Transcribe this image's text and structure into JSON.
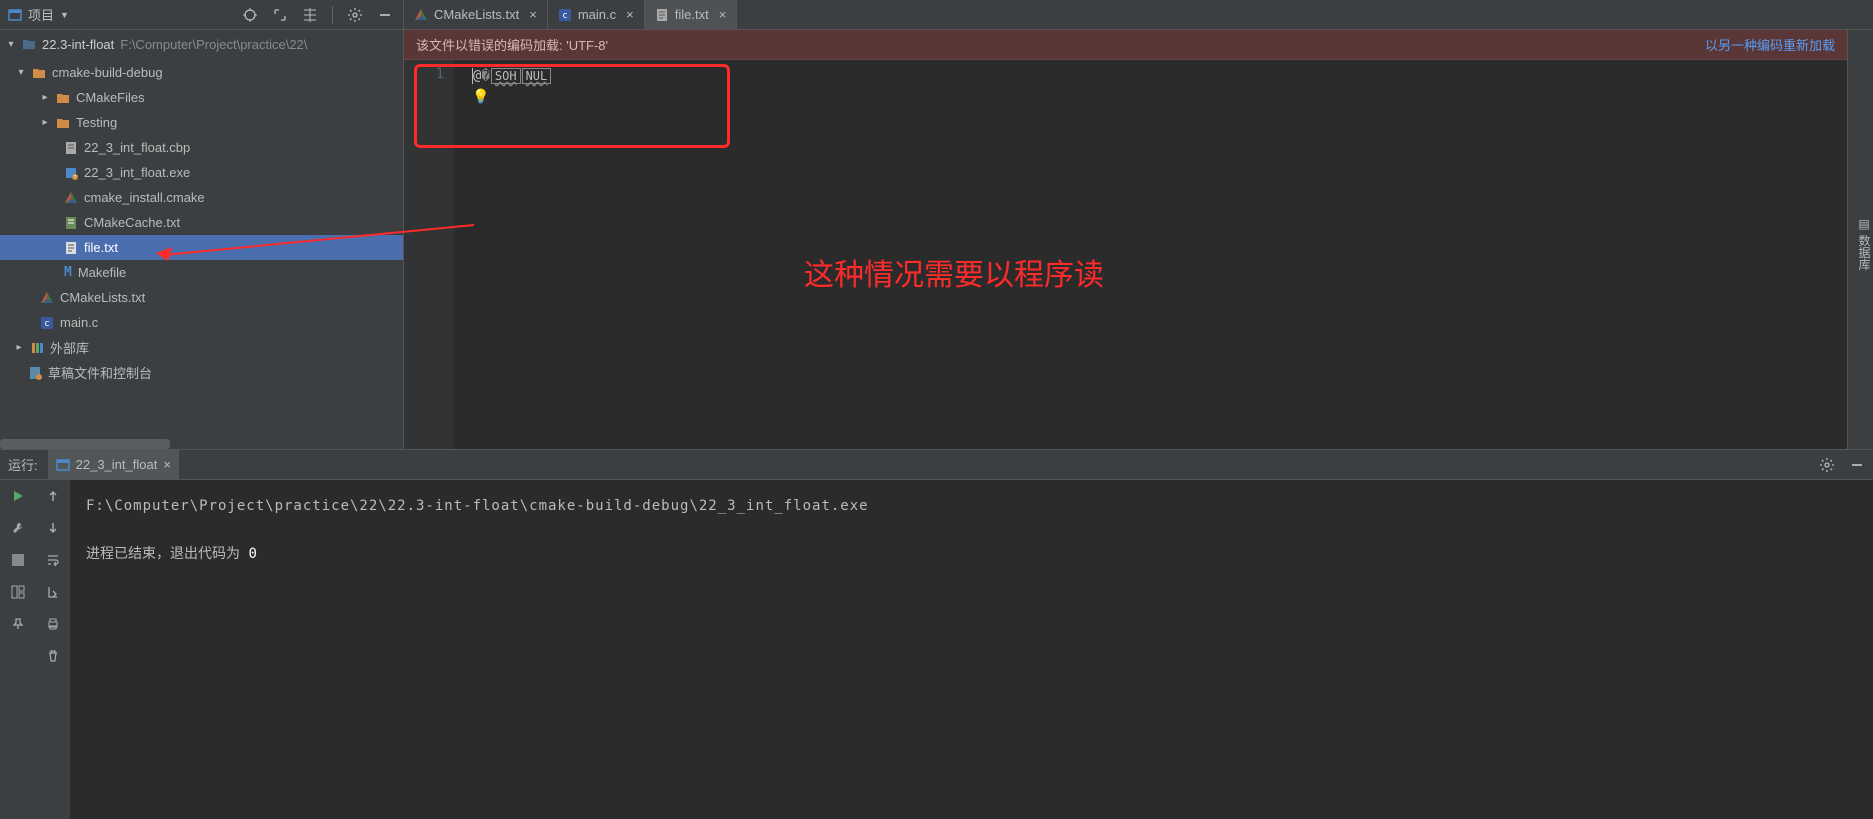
{
  "toolbar": {
    "project_label": "项目",
    "root": "22.3-int-float",
    "path": "F:\\Computer\\Project\\practice\\22\\"
  },
  "tabs": [
    {
      "label": "CMakeLists.txt",
      "icon": "cmake"
    },
    {
      "label": "main.c",
      "icon": "c-file"
    },
    {
      "label": "file.txt",
      "icon": "text-file",
      "active": true
    }
  ],
  "tree": {
    "root": "22.3-int-float",
    "items": [
      {
        "label": "cmake-build-debug",
        "type": "folder",
        "chev": "down",
        "indent": 0
      },
      {
        "label": "CMakeFiles",
        "type": "folder",
        "chev": "right",
        "indent": 1
      },
      {
        "label": "Testing",
        "type": "folder",
        "chev": "right",
        "indent": 1
      },
      {
        "label": "22_3_int_float.cbp",
        "type": "file",
        "icon": "text-file",
        "indent": 2
      },
      {
        "label": "22_3_int_float.exe",
        "type": "file",
        "icon": "exe",
        "indent": 2
      },
      {
        "label": "cmake_install.cmake",
        "type": "file",
        "icon": "cmake",
        "indent": 2
      },
      {
        "label": "CMakeCache.txt",
        "type": "file",
        "icon": "cache",
        "indent": 2
      },
      {
        "label": "file.txt",
        "type": "file",
        "icon": "text-file",
        "indent": 2,
        "selected": true
      },
      {
        "label": "Makefile",
        "type": "file",
        "icon": "makefile",
        "indent": 2
      },
      {
        "label": "CMakeLists.txt",
        "type": "file",
        "icon": "cmake",
        "indent": 1
      },
      {
        "label": "main.c",
        "type": "file",
        "icon": "c-file",
        "indent": 1
      }
    ],
    "external_lib": "外部库",
    "scratches": "草稿文件和控制台"
  },
  "notification": {
    "message": "该文件以错误的编码加载: 'UTF-8'",
    "action": "以另一种编码重新加载"
  },
  "editor": {
    "line_number": "1",
    "content_prefix": "@",
    "soh_label": "SOH",
    "nul_label": "NUL"
  },
  "annotation": {
    "text": "这种情况需要以程序读"
  },
  "run": {
    "label": "运行:",
    "tab": "22_3_int_float",
    "path": "F:\\Computer\\Project\\practice\\22\\22.3-int-float\\cmake-build-debug\\22_3_int_float.exe",
    "exit_text": "进程已结束，退出代码为 ",
    "exit_code": "0"
  },
  "right_strip": "数据库"
}
